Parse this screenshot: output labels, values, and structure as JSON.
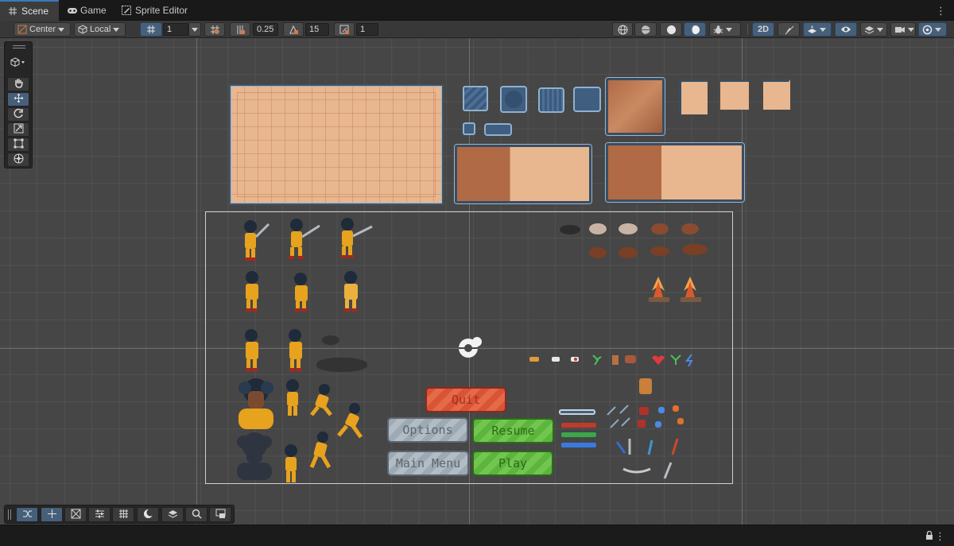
{
  "tabs": [
    {
      "label": "Scene",
      "icon": "grid-icon",
      "active": true
    },
    {
      "label": "Game",
      "icon": "gamepad-icon",
      "active": false
    },
    {
      "label": "Sprite Editor",
      "icon": "sprite-editor-icon",
      "active": false
    }
  ],
  "toolbar": {
    "pivot_label": "Center",
    "space_label": "Local",
    "grid_size": "1",
    "snap_increment": "0.25",
    "rotate_snap": "15",
    "scale_snap": "1",
    "mode_2d_label": "2D"
  },
  "scene": {
    "game_buttons": {
      "quit": "Quit",
      "options": "Options",
      "resume": "Resume",
      "main_menu": "Main Menu",
      "play": "Play"
    },
    "colors": {
      "quit": "#d95436",
      "options": "#9eaab3",
      "resume": "#5cb53c",
      "main_menu": "#9eaab3",
      "play": "#5cb53c",
      "panel": "#e8b68f",
      "frame": "#3f546b"
    }
  }
}
